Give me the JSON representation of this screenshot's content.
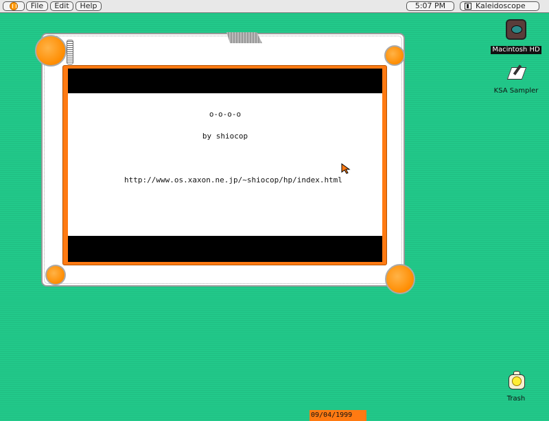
{
  "menubar": {
    "apple_label": "",
    "file_label": "File",
    "edit_label": "Edit",
    "help_label": "Help",
    "clock": "5:07 PM",
    "active_app": "Kaleidoscope"
  },
  "desktop": {
    "icons": [
      {
        "label": "Macintosh HD",
        "icon": "hard-drive-icon"
      },
      {
        "label": "KSA Sampler",
        "icon": "document-pen-icon"
      },
      {
        "label": "Trash",
        "icon": "trash-icon"
      }
    ],
    "background_color": "#22c98a"
  },
  "window": {
    "accent_color": "#ff7a12",
    "lines": {
      "title": "o-o-o-o",
      "author": "by shiocop",
      "url": "http://www.os.xaxon.ne.jp/~shiocop/hp/index.html"
    },
    "date": "09/04/1999"
  }
}
